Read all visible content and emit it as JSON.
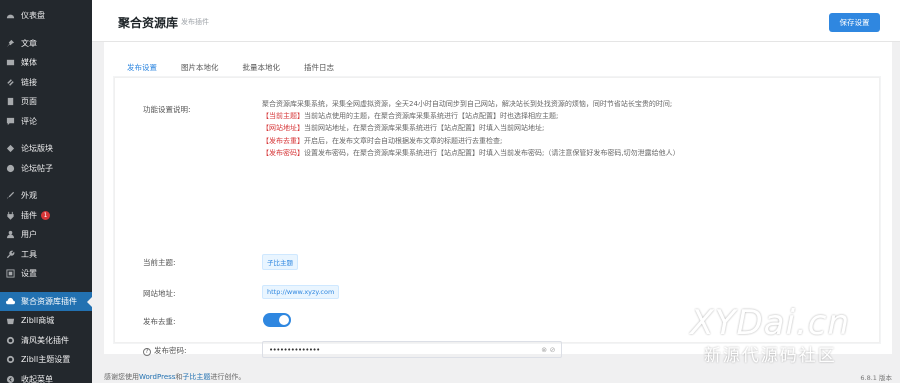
{
  "sidebar": {
    "items": [
      {
        "label": "仪表盘",
        "icon": "dashboard-icon"
      },
      {
        "label": "文章",
        "icon": "pin-icon"
      },
      {
        "label": "媒体",
        "icon": "media-icon"
      },
      {
        "label": "链接",
        "icon": "link-icon"
      },
      {
        "label": "页面",
        "icon": "page-icon"
      },
      {
        "label": "评论",
        "icon": "comment-icon"
      },
      {
        "label": "论坛版块",
        "icon": "forum-icon"
      },
      {
        "label": "论坛帖子",
        "icon": "forum-post-icon"
      },
      {
        "label": "外观",
        "icon": "brush-icon"
      },
      {
        "label": "插件",
        "icon": "plugin-icon",
        "badge": "1"
      },
      {
        "label": "用户",
        "icon": "user-icon"
      },
      {
        "label": "工具",
        "icon": "wrench-icon"
      },
      {
        "label": "设置",
        "icon": "settings-icon"
      },
      {
        "label": "聚合资源库插件",
        "icon": "cloud-icon",
        "active": true
      },
      {
        "label": "Zibll商城",
        "icon": "shop-icon"
      },
      {
        "label": "清风美化插件",
        "icon": "gear-icon"
      },
      {
        "label": "Zibll主题设置",
        "icon": "gear-icon"
      },
      {
        "label": "收起菜单",
        "icon": "collapse-icon"
      }
    ]
  },
  "header": {
    "title": "聚合资源库",
    "subtitle": "发布插件",
    "save_label": "保存设置"
  },
  "tabs": [
    "发布设置",
    "图片本地化",
    "批量本地化",
    "插件日志"
  ],
  "form": {
    "desc_label": "功能设置说明:",
    "desc_intro": "聚合资源库采集系统，采集全网虚拟资源，全天24小时自动同步到自己网站，解决站长到处找资源的烦恼，同时节省站长宝贵的时间;",
    "desc_lines": [
      {
        "tag": "【当前主题】",
        "text": "当前站点使用的主题，在聚合资源库采集系统进行【站点配置】时也选择相应主题;"
      },
      {
        "tag": "【网站地址】",
        "text": "当前网站地址，在聚合资源库采集系统进行【站点配置】时填入当前网站地址;"
      },
      {
        "tag": "【发布去重】",
        "text": "开启后，在发布文章时会自动根据发布文章的标题进行去重检查;"
      },
      {
        "tag": "【发布密码】",
        "text": "设置发布密码，在聚合资源库采集系统进行【站点配置】时填入当前发布密码;（请注意保管好发布密码,切勿泄露给他人）"
      }
    ],
    "theme_label": "当前主题:",
    "theme_value": "子比主题",
    "url_label": "网站地址:",
    "url_value": "http://www.xyzy.com",
    "dedupe_label": "发布去重:",
    "dedupe_on": true,
    "password_label": "发布密码:",
    "password_value": "••••••••••••••"
  },
  "footer": {
    "prefix": "感谢您使用",
    "wp": "WordPress",
    "and": "和",
    "theme": "子比主题",
    "suffix": "进行创作。",
    "version": "6.8.1 版本"
  },
  "watermark": {
    "big": "XYDai.cn",
    "small": "新源代源码社区"
  }
}
